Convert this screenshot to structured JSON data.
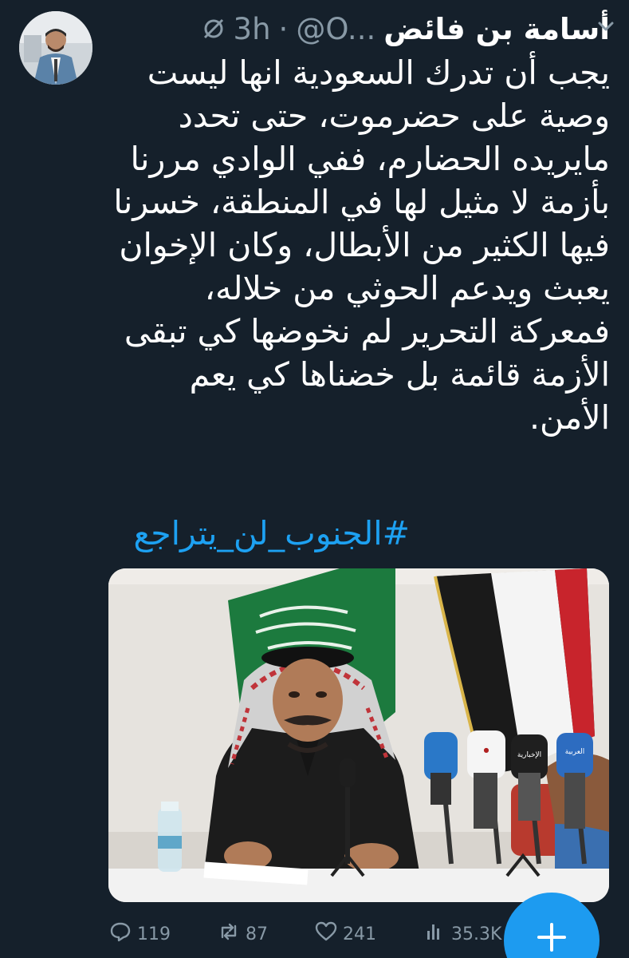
{
  "author": {
    "display_name": "أسامة بن فائض",
    "handle": "@O...",
    "separator": "·",
    "time": "3h"
  },
  "tweet": {
    "lines": [
      "يجب أن تدرك السعودية انها ليست",
      "وصية على حضرموت، حتى تحدد",
      "مايريده الحضارم، ففي الوادي مررنا",
      "بأزمة لا مثيل لها في المنطقة، خسرنا",
      "فيها الكثير من الأبطال، وكان الإخوان",
      "يعبث ويدعم الحوثي من خلاله،",
      "فمعركة التحرير لم نخوضها كي تبقى",
      "الأزمة قائمة بل خضناها كي يعم",
      "الأمن."
    ],
    "hashtag": "#الجنوب_لن_يتراجع"
  },
  "media": {
    "mic_labels": [
      "الإخبارية",
      "العربية"
    ]
  },
  "actions": {
    "replies": "119",
    "retweets": "87",
    "likes": "241",
    "views": "35.3K"
  },
  "colors": {
    "background": "#15202b",
    "text": "#ffffff",
    "muted": "#8899a6",
    "accent": "#1da1f2"
  },
  "icons": [
    "mute-icon",
    "chevron-down-icon",
    "reply-icon",
    "retweet-icon",
    "like-icon",
    "views-icon",
    "plus-icon"
  ]
}
